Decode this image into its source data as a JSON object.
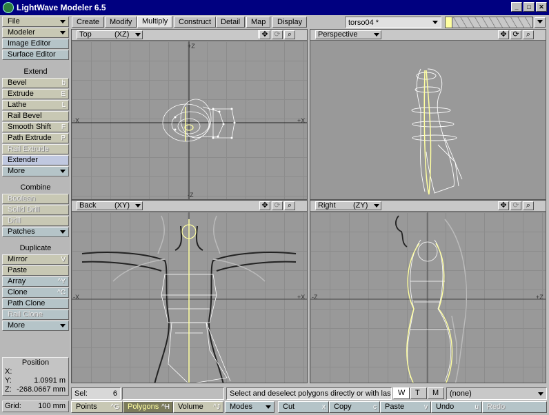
{
  "app": {
    "title": "LightWave Modeler 6.5"
  },
  "window_buttons": [
    "_",
    "□",
    "✕"
  ],
  "tabs": [
    "Create",
    "Modify",
    "Multiply",
    "Construct",
    "Detail",
    "Map",
    "Display"
  ],
  "active_tab": "Multiply",
  "object_selector": "torso04 *",
  "sidebar": {
    "top": [
      {
        "label": "File",
        "dropdown": true
      },
      {
        "label": "Modeler",
        "dropdown": true
      },
      {
        "label": "Image Editor"
      },
      {
        "label": "Surface Editor"
      }
    ],
    "extend_header": "Extend",
    "extend": [
      {
        "label": "Bevel",
        "key": "b"
      },
      {
        "label": "Extrude",
        "key": "E"
      },
      {
        "label": "Lathe",
        "key": "L"
      },
      {
        "label": "Rail Bevel",
        "key": ""
      },
      {
        "label": "Smooth Shift",
        "key": "F"
      },
      {
        "label": "Path Extrude",
        "key": "P"
      },
      {
        "label": "Rail Extrude",
        "key": "",
        "disabled": true
      },
      {
        "label": "Extender",
        "key": ""
      },
      {
        "label": "More",
        "dropdown": true
      }
    ],
    "combine_header": "Combine",
    "combine": [
      {
        "label": "Boolean",
        "disabled": true
      },
      {
        "label": "Solid Drill",
        "disabled": true
      },
      {
        "label": "Drill",
        "disabled": true
      },
      {
        "label": "Patches",
        "dropdown": true
      }
    ],
    "duplicate_header": "Duplicate",
    "duplicate": [
      {
        "label": "Mirror",
        "key": "V"
      },
      {
        "label": "Paste",
        "key": ""
      },
      {
        "label": "Array",
        "key": "^Y"
      },
      {
        "label": "Clone",
        "key": "^C"
      },
      {
        "label": "Path Clone",
        "key": ""
      },
      {
        "label": "Rail Clone",
        "key": "",
        "disabled": true
      },
      {
        "label": "More",
        "dropdown": true
      }
    ]
  },
  "position": {
    "label": "Position",
    "x_label": "X:",
    "x_value": "",
    "y_label": "Y:",
    "y_value": "1.0991 m",
    "z_label": "Z:",
    "z_value": "-268.0667 mm"
  },
  "grid": {
    "label": "Grid:",
    "value": "100 mm"
  },
  "viewports": [
    {
      "name": "Top",
      "axes": "(XZ)",
      "axis_labels": [
        "+Z",
        "-X",
        "+X",
        "-Z"
      ]
    },
    {
      "name": "Perspective",
      "axes": "",
      "axis_labels": []
    },
    {
      "name": "Back",
      "axes": "(XY)",
      "axis_labels": [
        "-X",
        "+X"
      ]
    },
    {
      "name": "Right",
      "axes": "(ZY)",
      "axis_labels": [
        "-Z",
        "+Z"
      ]
    }
  ],
  "viewport_icons": [
    "move-icon",
    "rotate-icon",
    "zoom-icon"
  ],
  "status": {
    "sel_label": "Sel:",
    "sel_value": "6",
    "message": "Select and deselect polygons directly or with las...",
    "wtm": [
      "W",
      "T",
      "M"
    ],
    "surface": "(none)"
  },
  "bottom": {
    "modes": [
      {
        "label": "Points",
        "key": "^G"
      },
      {
        "label": "Polygons",
        "key": "^H",
        "active": true
      },
      {
        "label": "Volume",
        "key": "^J"
      }
    ],
    "modes_menu": "Modes",
    "edit": [
      {
        "label": "Cut",
        "key": "x"
      },
      {
        "label": "Copy",
        "key": "c"
      },
      {
        "label": "Paste",
        "key": "v"
      },
      {
        "label": "Undo",
        "key": "u"
      },
      {
        "label": "Redo",
        "key": "",
        "disabled": true
      }
    ]
  },
  "colors": {
    "accent": "#000080",
    "selection": "#ffffa0",
    "sidebar_button": "#c8c8b4"
  }
}
